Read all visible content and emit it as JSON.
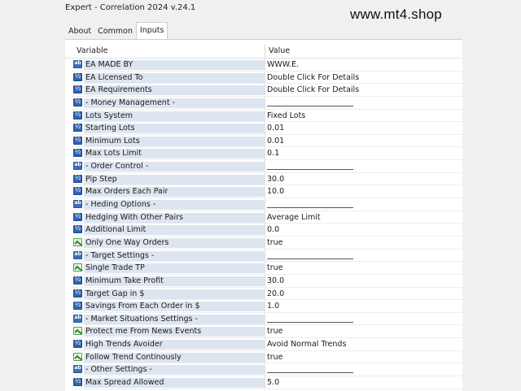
{
  "window": {
    "title": "Expert - Correlation 2024 v.24.1"
  },
  "watermark": "www.mt4.shop",
  "tabs": [
    {
      "label": "About",
      "active": false
    },
    {
      "label": "Common",
      "active": false
    },
    {
      "label": "Inputs",
      "active": true
    }
  ],
  "table": {
    "headers": {
      "variable": "Variable",
      "value": "Value"
    },
    "rows": [
      {
        "icon": "ab",
        "name": "EA MADE BY",
        "value": "WWW.E.",
        "separator": false
      },
      {
        "icon": "num",
        "name": "EA Licensed To",
        "value": "Double Click For Details",
        "separator": false
      },
      {
        "icon": "num",
        "name": "EA Requirements",
        "value": "Double Click For Details",
        "separator": false
      },
      {
        "icon": "num",
        "name": "- Money Management -",
        "value": "",
        "separator": true
      },
      {
        "icon": "num",
        "name": "Lots System",
        "value": "Fixed Lots",
        "separator": false
      },
      {
        "icon": "num",
        "name": "Starting Lots",
        "value": "0.01",
        "separator": false
      },
      {
        "icon": "num",
        "name": "Minimum Lots",
        "value": "0.01",
        "separator": false
      },
      {
        "icon": "num",
        "name": "Max Lots Limit",
        "value": "0.1",
        "separator": false
      },
      {
        "icon": "ab",
        "name": "- Order Control -",
        "value": "",
        "separator": true
      },
      {
        "icon": "num",
        "name": "Pip Step",
        "value": "30.0",
        "separator": false
      },
      {
        "icon": "num",
        "name": "Max Orders Each Pair",
        "value": "10.0",
        "separator": false
      },
      {
        "icon": "ab",
        "name": "- Heding Options -",
        "value": "",
        "separator": true
      },
      {
        "icon": "num",
        "name": "Hedging With Other Pairs",
        "value": "Average Limit",
        "separator": false
      },
      {
        "icon": "num",
        "name": "Additional Limit",
        "value": "0.0",
        "separator": false
      },
      {
        "icon": "bool",
        "name": "Only One Way Orders",
        "value": "true",
        "separator": false
      },
      {
        "icon": "ab",
        "name": "- Target Settings -",
        "value": "",
        "separator": true
      },
      {
        "icon": "bool",
        "name": "Single Trade TP",
        "value": "true",
        "separator": false
      },
      {
        "icon": "num",
        "name": "Minimum Take Profit",
        "value": "30.0",
        "separator": false
      },
      {
        "icon": "num",
        "name": "Target Gap in $",
        "value": "20.0",
        "separator": false
      },
      {
        "icon": "num",
        "name": "Savings From Each Order in $",
        "value": "1.0",
        "separator": false
      },
      {
        "icon": "ab",
        "name": "- Market Situations Settings -",
        "value": "",
        "separator": true
      },
      {
        "icon": "bool",
        "name": "Protect me From News Events",
        "value": "true",
        "separator": false
      },
      {
        "icon": "num",
        "name": "High Trends Avoider",
        "value": "Avoid Normal Trends",
        "separator": false
      },
      {
        "icon": "bool",
        "name": "Follow Trend Continously",
        "value": "true",
        "separator": false
      },
      {
        "icon": "ab",
        "name": "- Other Settings -",
        "value": "",
        "separator": true
      },
      {
        "icon": "num",
        "name": "Max Spread Allowed",
        "value": "5.0",
        "separator": false
      }
    ]
  }
}
